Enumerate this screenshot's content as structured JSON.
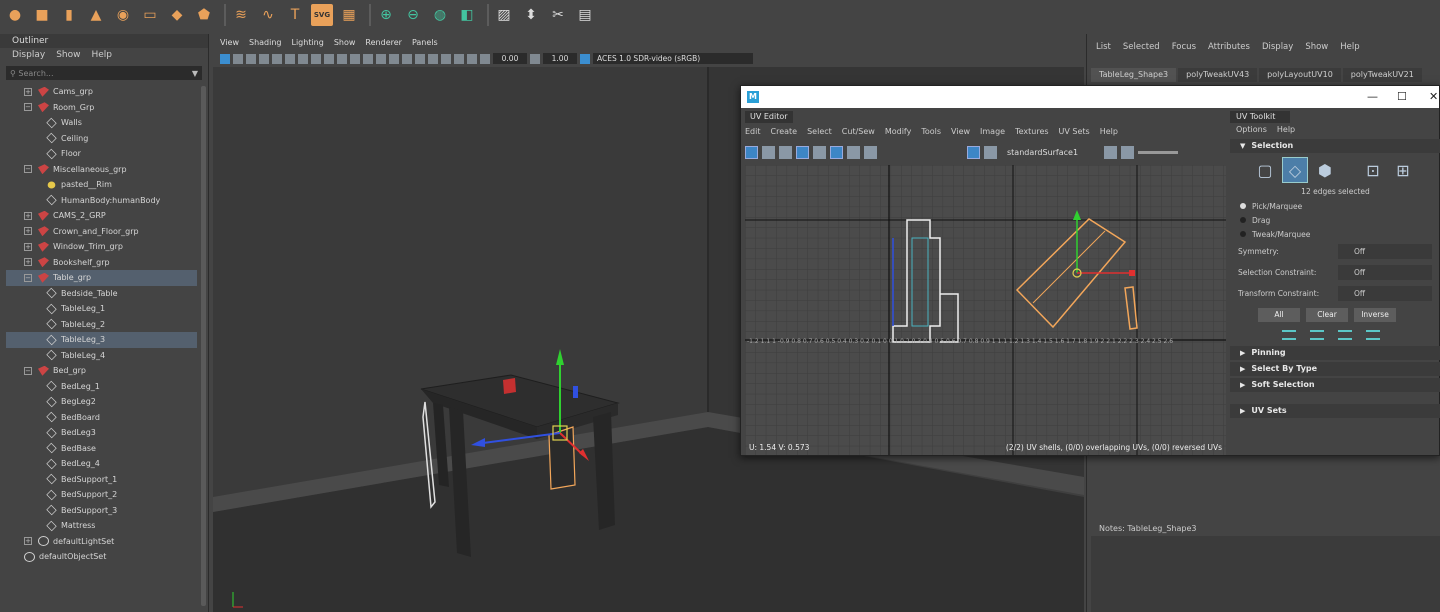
{
  "shelf": {
    "icons": [
      "sphere-icon",
      "cube-icon",
      "cylinder-icon",
      "cone-icon",
      "torus-icon",
      "plane-icon",
      "disc-icon",
      "platonic-icon",
      "sweep-icon",
      "helix-icon",
      "text-icon",
      "svg-icon",
      "grid-icon",
      "combine-icon",
      "separate-icon",
      "smooth-icon",
      "bevel-icon",
      "bridge-icon",
      "extrude-icon",
      "multicut-icon",
      "uv-icon"
    ],
    "text_label": "T",
    "svg_label": "SVG"
  },
  "outliner": {
    "title": "Outliner",
    "menu": [
      "Display",
      "Show",
      "Help"
    ],
    "search_placeholder": "Search...",
    "items": [
      {
        "label": "Cams_grp",
        "type": "grp",
        "depth": 0,
        "expander": "+"
      },
      {
        "label": "Room_Grp",
        "type": "grp",
        "depth": 0,
        "expander": "−"
      },
      {
        "label": "Walls",
        "type": "mesh",
        "depth": 1
      },
      {
        "label": "Ceiling",
        "type": "mesh",
        "depth": 1
      },
      {
        "label": "Floor",
        "type": "mesh",
        "depth": 1
      },
      {
        "label": "Miscellaneous_grp",
        "type": "grp",
        "depth": 0,
        "expander": "−"
      },
      {
        "label": "pasted__Rim",
        "type": "light",
        "depth": 1
      },
      {
        "label": "HumanBody:humanBody",
        "type": "mesh",
        "depth": 1
      },
      {
        "label": "CAMS_2_GRP",
        "type": "grp",
        "depth": 0,
        "expander": "+"
      },
      {
        "label": "Crown_and_Floor_grp",
        "type": "grp",
        "depth": 0,
        "expander": "+"
      },
      {
        "label": "Window_Trim_grp",
        "type": "grp",
        "depth": 0,
        "expander": "+"
      },
      {
        "label": "Bookshelf_grp",
        "type": "grp",
        "depth": 0,
        "expander": "+"
      },
      {
        "label": "Table_grp",
        "type": "grp",
        "depth": 0,
        "expander": "−",
        "selected": true
      },
      {
        "label": "Bedside_Table",
        "type": "mesh",
        "depth": 1
      },
      {
        "label": "TableLeg_1",
        "type": "mesh",
        "depth": 1
      },
      {
        "label": "TableLeg_2",
        "type": "mesh",
        "depth": 1
      },
      {
        "label": "TableLeg_3",
        "type": "mesh",
        "depth": 1,
        "selected": true
      },
      {
        "label": "TableLeg_4",
        "type": "mesh",
        "depth": 1
      },
      {
        "label": "Bed_grp",
        "type": "grp",
        "depth": 0,
        "expander": "−"
      },
      {
        "label": "BedLeg_1",
        "type": "mesh",
        "depth": 1
      },
      {
        "label": "BegLeg2",
        "type": "mesh",
        "depth": 1
      },
      {
        "label": "BedBoard",
        "type": "mesh",
        "depth": 1
      },
      {
        "label": "BedLeg3",
        "type": "mesh",
        "depth": 1
      },
      {
        "label": "BedBase",
        "type": "mesh",
        "depth": 1
      },
      {
        "label": "BedLeg_4",
        "type": "mesh",
        "depth": 1
      },
      {
        "label": "BedSupport_1",
        "type": "mesh",
        "depth": 1
      },
      {
        "label": "BedSupport_2",
        "type": "mesh",
        "depth": 1
      },
      {
        "label": "BedSupport_3",
        "type": "mesh",
        "depth": 1
      },
      {
        "label": "Mattress",
        "type": "mesh",
        "depth": 1
      },
      {
        "label": "defaultLightSet",
        "type": "set",
        "depth": 0,
        "expander": "+"
      },
      {
        "label": "defaultObjectSet",
        "type": "set",
        "depth": 0
      }
    ]
  },
  "viewport": {
    "menu": [
      "View",
      "Shading",
      "Lighting",
      "Show",
      "Renderer",
      "Panels"
    ],
    "exposure": "0.00",
    "gamma": "1.00",
    "color_space": "ACES 1.0 SDR-video (sRGB)"
  },
  "attribute_editor": {
    "menu": [
      "List",
      "Selected",
      "Focus",
      "Attributes",
      "Display",
      "Show",
      "Help"
    ],
    "tabs": [
      "TableLeg_Shape3",
      "polyTweakUV43",
      "polyLayoutUV10",
      "polyTweakUV21"
    ],
    "notes_label": "Notes:  TableLeg_Shape3"
  },
  "uv_editor": {
    "panel_title": "UV Editor",
    "logo_letter": "M",
    "menu": [
      "Edit",
      "Create",
      "Select",
      "Cut/Sew",
      "Modify",
      "Tools",
      "View",
      "Image",
      "Textures",
      "UV Sets",
      "Help"
    ],
    "shader": "standardSurface1",
    "uv_readout": "U:  1.54  V:  0.573",
    "status": "(2/2) UV shells, (0/0) overlapping UVs, (0/0) reversed UVs",
    "axis_x_labels": "-1.2 1.1 1 -0.9 0.8 0.7 0.6 0.5 0.4 0.3 0.2 0.1 0 0.1 0.2 0.3 0.4 0.5 0.6 0.7 0.8 0.9 1 1.1 1.2 1.3 1.4 1.5 1.6 1.7 1.8 1.9 2 2.1 2.2 2.3 2.4 2.5 2.6"
  },
  "uv_toolkit": {
    "title": "UV Toolkit",
    "menu": [
      "Options",
      "Help"
    ],
    "selection_header": "Selection",
    "selected_count": "12 edges selected",
    "modes": [
      "Pick/Marquee",
      "Drag",
      "Tweak/Marquee"
    ],
    "symmetry_label": "Symmetry:",
    "symmetry_value": "Off",
    "sel_constraint_label": "Selection Constraint:",
    "sel_constraint_value": "Off",
    "xform_constraint_label": "Transform Constraint:",
    "xform_constraint_value": "Off",
    "buttons": [
      "All",
      "Clear",
      "Inverse"
    ],
    "sections": [
      "Pinning",
      "Select By Type",
      "Soft Selection",
      "UV Sets"
    ]
  },
  "colors": {
    "selection_orange": "#f2a65a",
    "accent_blue": "#3d86c6",
    "axis_red": "#e03030",
    "axis_green": "#30d030",
    "axis_blue": "#3050e0"
  }
}
